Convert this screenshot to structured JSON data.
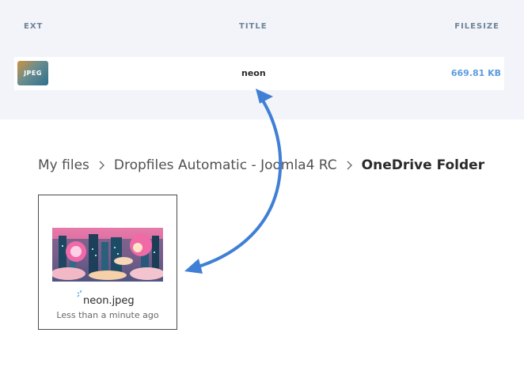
{
  "table": {
    "headers": {
      "ext": "EXT",
      "title": "TITLE",
      "filesize": "FILESIZE"
    },
    "rows": [
      {
        "ext": "JPEG",
        "title": "neon",
        "filesize": "669.81 KB"
      }
    ]
  },
  "breadcrumb": {
    "items": [
      "My files",
      "Dropfiles Automatic - Joomla4 RC",
      "OneDrive Folder"
    ]
  },
  "file": {
    "name": "neon.jpeg",
    "modified": "Less than a minute ago"
  },
  "colors": {
    "accent": "#5a9ce0",
    "arrow": "#3f7fd6",
    "panel_bg": "#f2f4f9",
    "header_text": "#6f8499"
  },
  "icons": {
    "breadcrumb_separator": "chevron-right-icon",
    "sync": "sync-spinner-icon"
  }
}
